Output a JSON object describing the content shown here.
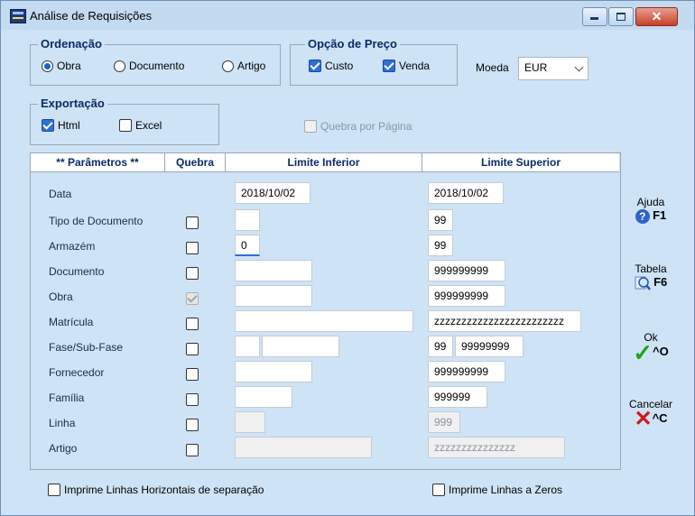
{
  "window": {
    "title": "Análise de Requisições"
  },
  "ordenacao": {
    "legend": "Ordenação",
    "options": [
      {
        "label": "Obra",
        "selected": true
      },
      {
        "label": "Documento",
        "selected": false
      },
      {
        "label": "Artigo",
        "selected": false
      }
    ]
  },
  "opcao_preco": {
    "legend": "Opção de Preço",
    "custo": {
      "label": "Custo",
      "checked": true
    },
    "venda": {
      "label": "Venda",
      "checked": true
    }
  },
  "moeda": {
    "label": "Moeda",
    "value": "EUR"
  },
  "exportacao": {
    "legend": "Exportação",
    "html": {
      "label": "Html",
      "checked": true
    },
    "excel": {
      "label": "Excel",
      "checked": false
    }
  },
  "quebra_pagina": {
    "label": "Quebra por Página",
    "checked": false
  },
  "table": {
    "headers": [
      "** Parâmetros **",
      "Quebra",
      "Limite Inferior",
      "Limite Superior"
    ],
    "rows": [
      {
        "label": "Data",
        "inf": "2018/10/02",
        "sup": "2018/10/02"
      },
      {
        "label": "Tipo de Documento",
        "inf": "",
        "sup": "99"
      },
      {
        "label": "Armazém",
        "inf": "0",
        "sup": "99"
      },
      {
        "label": "Documento",
        "inf": "",
        "sup": "999999999"
      },
      {
        "label": "Obra",
        "inf": "",
        "sup": "999999999"
      },
      {
        "label": "Matrícula",
        "inf": "",
        "sup": "zzzzzzzzzzzzzzzzzzzzzzzz"
      },
      {
        "label": "Fase/Sub-Fase",
        "inf_a": "",
        "inf_b": "",
        "sup_a": "99",
        "sup_b": "99999999"
      },
      {
        "label": "Fornecedor",
        "inf": "",
        "sup": "999999999"
      },
      {
        "label": "Família",
        "inf": "",
        "sup": "999999"
      },
      {
        "label": "Linha",
        "inf": "",
        "sup": "999"
      },
      {
        "label": "Artigo",
        "inf": "",
        "sup": "zzzzzzzzzzzzzzz"
      }
    ]
  },
  "bottom": {
    "linhas_horizontais": "Imprime Linhas Horizontais de separação",
    "linhas_zeros": "Imprime Linhas a Zeros"
  },
  "side": {
    "ajuda": {
      "label": "Ajuda",
      "key": "F1"
    },
    "tabela": {
      "label": "Tabela",
      "key": "F6"
    },
    "ok": {
      "label": "Ok",
      "key": "^O"
    },
    "cancelar": {
      "label": "Cancelar",
      "key": "^C"
    }
  }
}
